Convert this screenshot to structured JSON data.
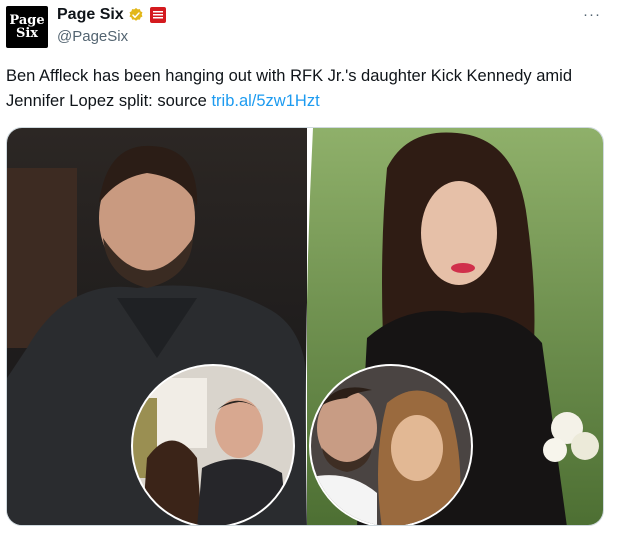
{
  "account": {
    "avatar_text_line1": "Page",
    "avatar_text_line2": "Six",
    "name": "Page Six",
    "handle": "@PageSix",
    "verified_icon": "gold-check-icon",
    "affiliate_badge_icon": "nypost-badge-icon"
  },
  "menu": {
    "more_label": "···"
  },
  "tweet": {
    "text": "Ben Affleck has been hanging out with RFK Jr.'s daughter Kick Kennedy amid Jennifer Lopez split: source ",
    "link": "trib.al/5zw1Hzt"
  },
  "colors": {
    "link": "#1d9bf0",
    "verified": "#e2b719",
    "badge": "#d41a1f"
  }
}
